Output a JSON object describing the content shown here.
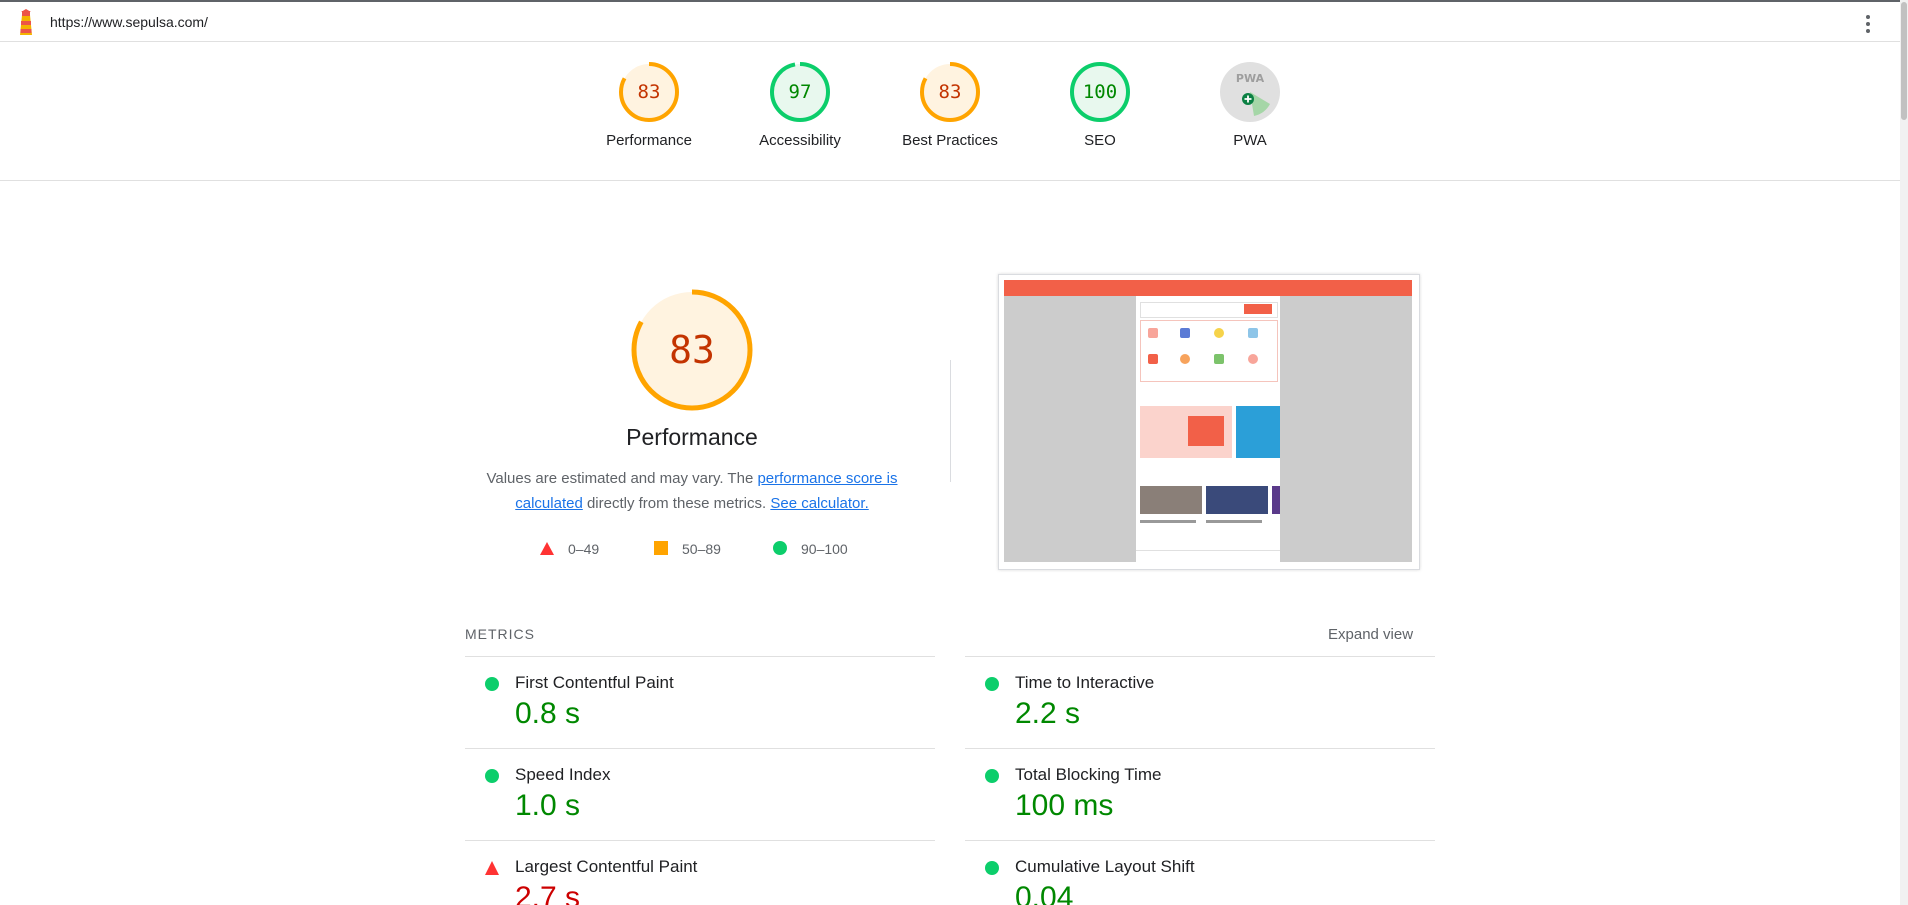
{
  "url": "https://www.sepulsa.com/",
  "scores": [
    {
      "label": "Performance",
      "value": "83",
      "color": "#ffa400",
      "text_color": "#c33300",
      "bg": "#fff3e0",
      "fraction": 0.83
    },
    {
      "label": "Accessibility",
      "value": "97",
      "color": "#0cce6b",
      "text_color": "#008800",
      "bg": "#e8f8ee",
      "fraction": 0.97
    },
    {
      "label": "Best Practices",
      "value": "83",
      "color": "#ffa400",
      "text_color": "#c33300",
      "bg": "#fff3e0",
      "fraction": 0.83
    },
    {
      "label": "SEO",
      "value": "100",
      "color": "#0cce6b",
      "text_color": "#008800",
      "bg": "#e8f8ee",
      "fraction": 1.0
    },
    {
      "label": "PWA",
      "value": "PWA",
      "color": "#9e9e9e",
      "text_color": "#9e9e9e",
      "bg": "#e0e0e0",
      "fraction": 0
    }
  ],
  "performance": {
    "score": "83",
    "title": "Performance",
    "desc_prefix": "Values are estimated and may vary. The ",
    "desc_link1": "performance score is calculated",
    "desc_middle": " directly from these metrics. ",
    "desc_link2": "See calculator."
  },
  "legend": [
    {
      "shape": "triangle",
      "color": "#ff3333",
      "label": "0–49"
    },
    {
      "shape": "square",
      "color": "#ffa400",
      "label": "50–89"
    },
    {
      "shape": "circle",
      "color": "#0cce6b",
      "label": "90–100"
    }
  ],
  "metrics_heading": "METRICS",
  "expand_label": "Expand view",
  "metrics": [
    {
      "name": "First Contentful Paint",
      "value": "0.8 s",
      "status": "pass",
      "color": "#008800"
    },
    {
      "name": "Time to Interactive",
      "value": "2.2 s",
      "status": "pass",
      "color": "#008800"
    },
    {
      "name": "Speed Index",
      "value": "1.0 s",
      "status": "pass",
      "color": "#008800"
    },
    {
      "name": "Total Blocking Time",
      "value": "100 ms",
      "status": "pass",
      "color": "#008800"
    },
    {
      "name": "Largest Contentful Paint",
      "value": "2.7 s",
      "status": "fail",
      "color": "#cc0000"
    },
    {
      "name": "Cumulative Layout Shift",
      "value": "0.04",
      "status": "pass",
      "color": "#008800"
    }
  ],
  "icons": {
    "logo": "lighthouse-icon",
    "menu": "kebab-menu-icon"
  }
}
